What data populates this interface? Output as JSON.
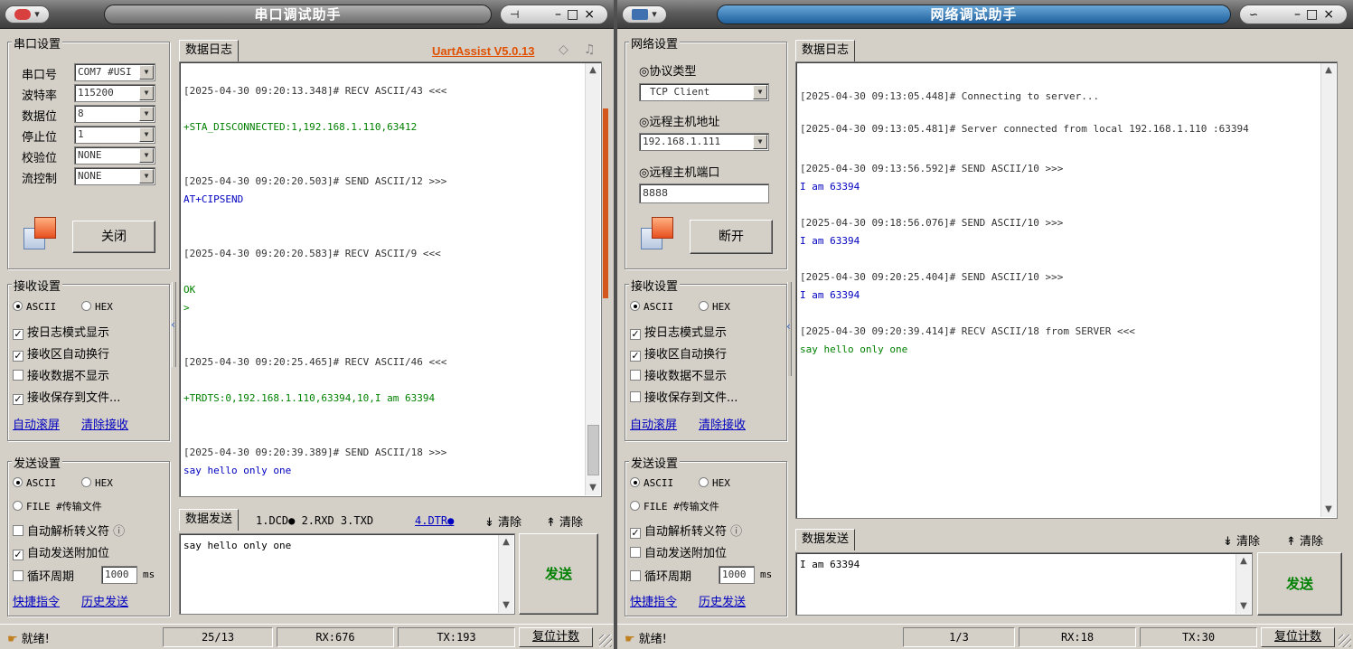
{
  "serial": {
    "title": "串口调试助手",
    "brand": "UartAssist V5.0.13",
    "port_group": "串口设置",
    "port_rows": [
      {
        "label": "串口号",
        "value": "COM7 #USI"
      },
      {
        "label": "波特率",
        "value": "115200"
      },
      {
        "label": "数据位",
        "value": "8"
      },
      {
        "label": "停止位",
        "value": "1"
      },
      {
        "label": "校验位",
        "value": "NONE"
      },
      {
        "label": "流控制",
        "value": "NONE"
      }
    ],
    "close_btn": "关闭",
    "recv_group": "接收设置",
    "recv_ascii": "ASCII",
    "recv_hex": "HEX",
    "recv_opts": [
      {
        "label": "按日志模式显示",
        "checked": true
      },
      {
        "label": "接收区自动换行",
        "checked": true
      },
      {
        "label": "接收数据不显示",
        "checked": false
      },
      {
        "label": "接收保存到文件...",
        "checked": true
      }
    ],
    "recv_links": [
      "自动滚屏",
      "清除接收"
    ],
    "send_group": "发送设置",
    "send_ascii": "ASCII",
    "send_hex": "HEX",
    "send_file": "FILE #传输文件",
    "send_opts": [
      {
        "label": "自动解析转义符",
        "checked": false
      },
      {
        "label": "自动发送附加位",
        "checked": true
      }
    ],
    "cycle_label": "循环周期",
    "cycle_value": "1000",
    "cycle_unit": "ms",
    "send_links": [
      "快捷指令",
      "历史发送"
    ],
    "log_tab": "数据日志",
    "log": [
      {
        "t": "[2025-04-30 09:20:13.348]# RECV ASCII/43 <<<",
        "c": "#333"
      },
      {
        "t": "+STA_DISCONNECTED:1,192.168.1.110,63412",
        "c": "#008000"
      },
      {
        "t": "[2025-04-30 09:20:20.503]# SEND ASCII/12 >>>",
        "c": "#333"
      },
      {
        "t": "AT+CIPSEND",
        "c": "#0000c0"
      },
      {
        "t": "[2025-04-30 09:20:20.583]# RECV ASCII/9 <<<",
        "c": "#333"
      },
      {
        "t": "OK",
        "c": "#008000"
      },
      {
        "t": ">",
        "c": "#008000"
      },
      {
        "t": "[2025-04-30 09:20:25.465]# RECV ASCII/46 <<<",
        "c": "#333"
      },
      {
        "t": "+TRDTS:0,192.168.1.110,63394,10,I am 63394",
        "c": "#008000"
      },
      {
        "t": "[2025-04-30 09:20:39.389]# SEND ASCII/18 >>>",
        "c": "#333"
      },
      {
        "t": "say hello only one",
        "c": "#0000c0"
      }
    ],
    "send_tab": "数据发送",
    "pins": "1.DCD● 2.RXD 3.TXD",
    "dtr": "4.DTR●",
    "clear1": "清除",
    "clear2": "清除",
    "send_text": "say hello only one",
    "send_btn": "发送",
    "status": {
      "ready": "就绪!",
      "pos": "25/13",
      "rx": "RX:676",
      "tx": "TX:193",
      "reset": "复位计数"
    }
  },
  "net": {
    "title": "网络调试助手",
    "net_group": "网络设置",
    "proto_label": "◎协议类型",
    "proto_value": "TCP Client",
    "host_label": "◎远程主机地址",
    "host_value": "192.168.1.111",
    "port_label": "◎远程主机端口",
    "port_value": "8888",
    "disc_btn": "断开",
    "recv_group": "接收设置",
    "recv_ascii": "ASCII",
    "recv_hex": "HEX",
    "recv_opts": [
      {
        "label": "按日志模式显示",
        "checked": true
      },
      {
        "label": "接收区自动换行",
        "checked": true
      },
      {
        "label": "接收数据不显示",
        "checked": false
      },
      {
        "label": "接收保存到文件...",
        "checked": false
      }
    ],
    "recv_links": [
      "自动滚屏",
      "清除接收"
    ],
    "send_group": "发送设置",
    "send_ascii": "ASCII",
    "send_hex": "HEX",
    "send_file": "FILE #传输文件",
    "send_opts": [
      {
        "label": "自动解析转义符",
        "checked": true
      },
      {
        "label": "自动发送附加位",
        "checked": false
      }
    ],
    "cycle_label": "循环周期",
    "cycle_value": "1000",
    "cycle_unit": "ms",
    "send_links": [
      "快捷指令",
      "历史发送"
    ],
    "log_tab": "数据日志",
    "log": [
      {
        "t": "[2025-04-30 09:13:05.448]# Connecting to server...",
        "c": "#333"
      },
      {
        "t": "[2025-04-30 09:13:05.481]# Server connected from local 192.168.1.110 :63394",
        "c": "#333"
      },
      {
        "t": "[2025-04-30 09:13:56.592]# SEND ASCII/10 >>>",
        "c": "#333"
      },
      {
        "t": "I am 63394",
        "c": "#0000c0"
      },
      {
        "t": "[2025-04-30 09:18:56.076]# SEND ASCII/10 >>>",
        "c": "#333"
      },
      {
        "t": "I am 63394",
        "c": "#0000c0"
      },
      {
        "t": "[2025-04-30 09:20:25.404]# SEND ASCII/10 >>>",
        "c": "#333"
      },
      {
        "t": "I am 63394",
        "c": "#0000c0"
      },
      {
        "t": "[2025-04-30 09:20:39.414]# RECV ASCII/18 from SERVER <<<",
        "c": "#333"
      },
      {
        "t": "say hello only one",
        "c": "#008000"
      }
    ],
    "send_tab": "数据发送",
    "clear1": "清除",
    "clear2": "清除",
    "send_text": "I am 63394",
    "send_btn": "发送",
    "status": {
      "ready": "就绪!",
      "pos": "1/3",
      "rx": "RX:18",
      "tx": "TX:30",
      "reset": "复位计数"
    }
  }
}
